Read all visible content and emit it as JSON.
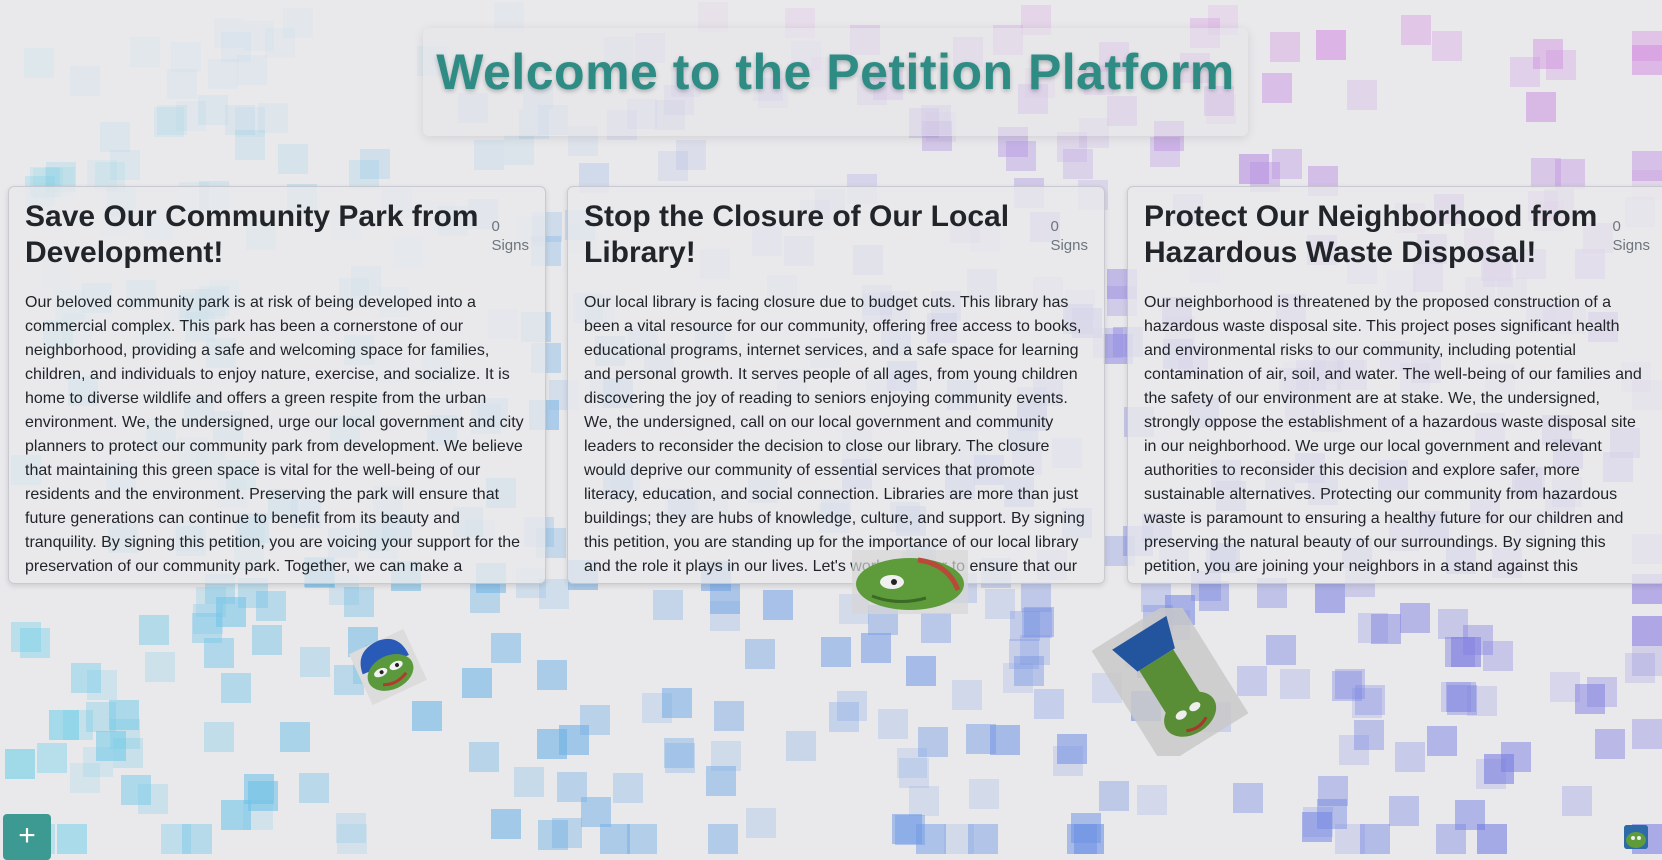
{
  "header": {
    "title": "Welcome to the Petition Platform"
  },
  "petitions": [
    {
      "title": "Save Our Community Park from Development!",
      "sign_count": "0",
      "sign_label": "Signs",
      "description": "Our beloved community park is at risk of being developed into a commercial complex. This park has been a cornerstone of our neighborhood, providing a safe and welcoming space for families, children, and individuals to enjoy nature, exercise, and socialize. It is home to diverse wildlife and offers a green respite from the urban environment. We, the undersigned, urge our local government and city planners to protect our community park from development. We believe that maintaining this green space is vital for the well-being of our residents and the environment. Preserving the park will ensure that future generations can continue to benefit from its beauty and tranquility. By signing this petition, you are voicing your support for the preservation of our community park. Together, we can make a difference and safeguard this precious resource for generations to come."
    },
    {
      "title": "Stop the Closure of Our Local Library!",
      "sign_count": "0",
      "sign_label": "Signs",
      "description": "Our local library is facing closure due to budget cuts. This library has been a vital resource for our community, offering free access to books, educational programs, internet services, and a safe space for learning and personal growth. It serves people of all ages, from young children discovering the joy of reading to seniors enjoying community events. We, the undersigned, call on our local government and community leaders to reconsider the decision to close our library. The closure would deprive our community of essential services that promote literacy, education, and social connection. Libraries are more than just buildings; they are hubs of knowledge, culture, and support. By signing this petition, you are standing up for the importance of our local library and the role it plays in our lives. Let's work together to ensure that our library remains open and continues to serve as a beacon of learning."
    },
    {
      "title": "Protect Our Neighborhood from Hazardous Waste Disposal!",
      "sign_count": "0",
      "sign_label": "Signs",
      "description": "Our neighborhood is threatened by the proposed construction of a hazardous waste disposal site. This project poses significant health and environmental risks to our community, including potential contamination of air, soil, and water. The well-being of our families and the safety of our environment are at stake. We, the undersigned, strongly oppose the establishment of a hazardous waste disposal site in our neighborhood. We urge our local government and relevant authorities to reconsider this decision and explore safer, more sustainable alternatives. Protecting our community from hazardous waste is paramount to ensuring a healthy future for our children and preserving the natural beauty of our surroundings. By signing this petition, you are joining your neighbors in a stand against this dangerous proposal and advocating for a cleaner, healthier neighborhood."
    }
  ],
  "actions": {
    "add_label": "+"
  },
  "colors": {
    "title": "#2f8c85",
    "add_button": "#3d9a92",
    "bg_square_topright": "#d98ee0",
    "bg_square_bottomleft": "#6fd0e8",
    "bg_square_bottomright": "#6c6ee0"
  },
  "icons": {
    "add": "plus-icon",
    "stickers": [
      "pepe-sticker",
      "pepe-sticker",
      "pepe-sticker"
    ],
    "avatar": "pepe-avatar"
  }
}
